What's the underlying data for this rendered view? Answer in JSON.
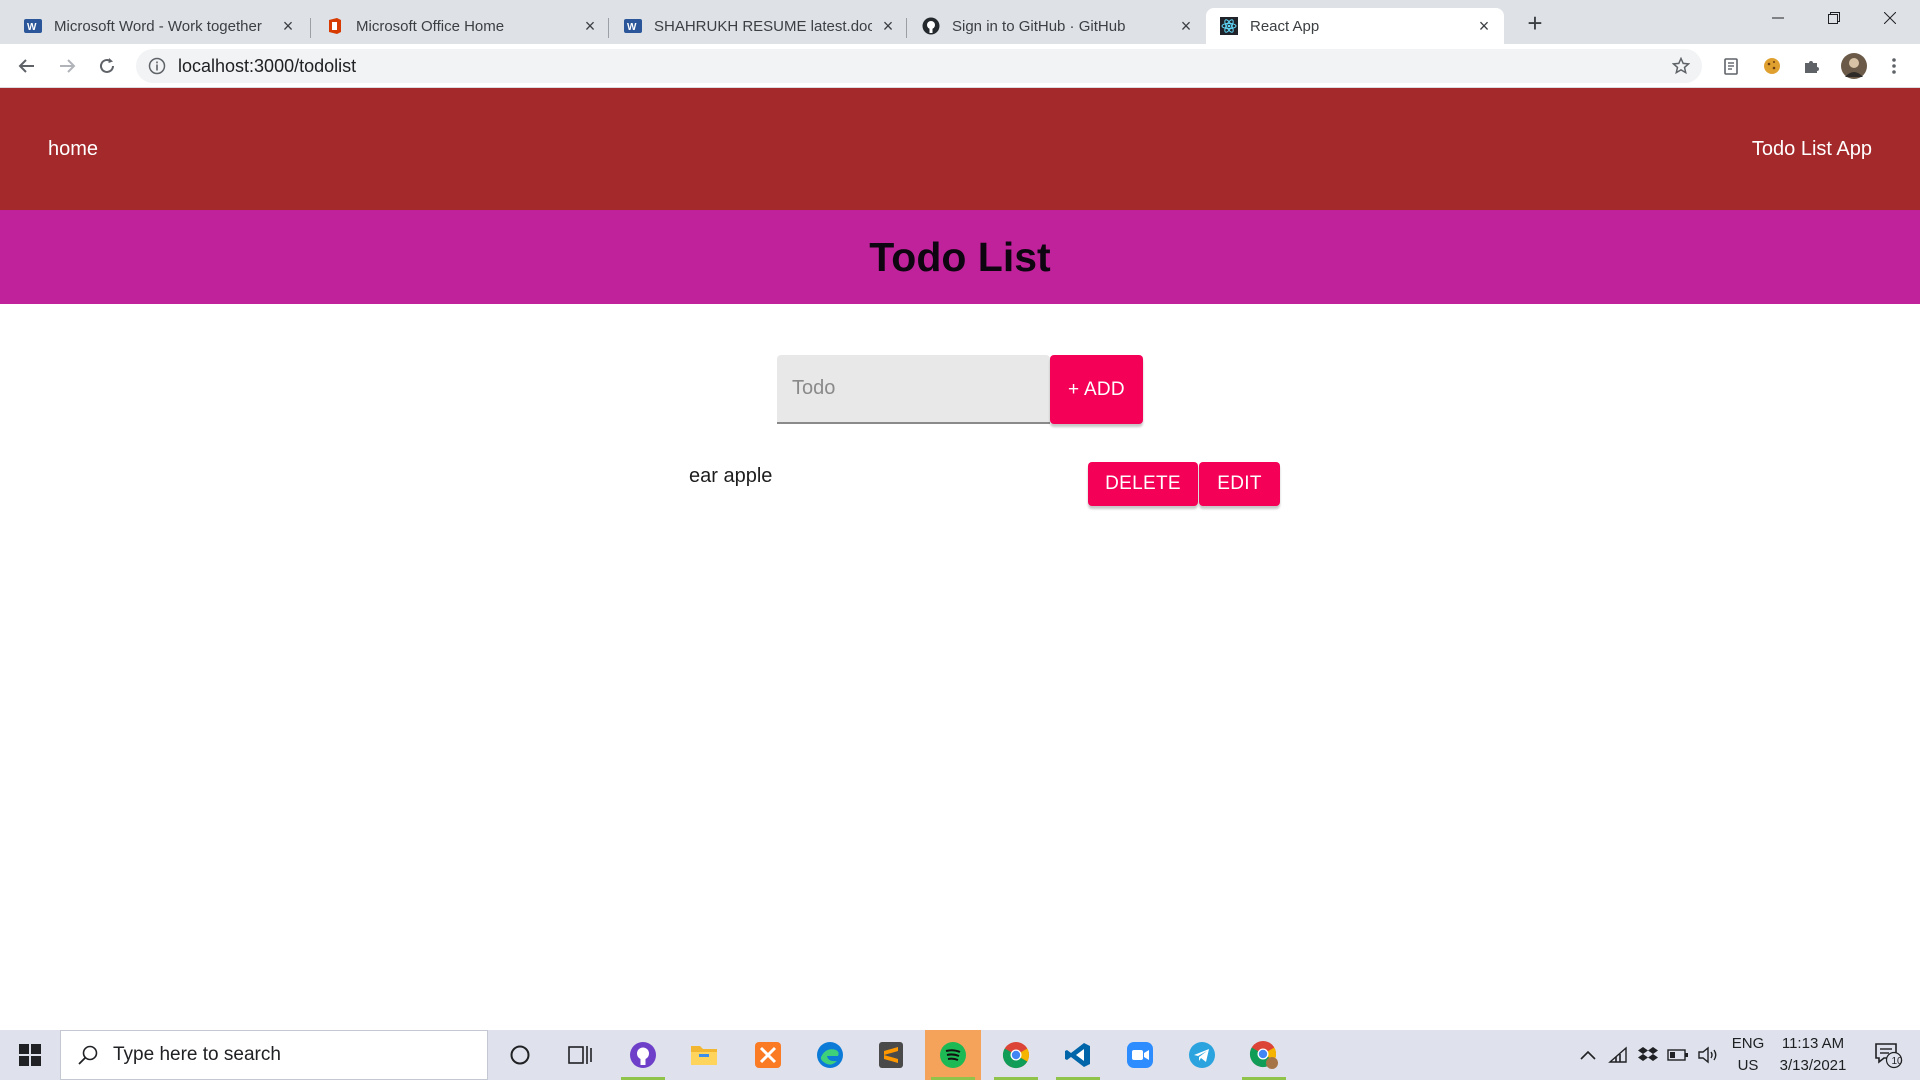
{
  "browser": {
    "tabs": [
      {
        "title": "Microsoft Word - Work together",
        "icon": "word-icon",
        "active": false
      },
      {
        "title": "Microsoft Office Home",
        "icon": "office-icon",
        "active": false
      },
      {
        "title": "SHAHRUKH RESUME latest.docx",
        "icon": "word-icon",
        "active": false
      },
      {
        "title": "Sign in to GitHub · GitHub",
        "icon": "github-icon",
        "active": false
      },
      {
        "title": "React App",
        "icon": "react-icon",
        "active": true
      }
    ],
    "url": "localhost:3000/todolist"
  },
  "app": {
    "nav_home": "home",
    "brand": "Todo List App",
    "title": "Todo List",
    "input_placeholder": "Todo",
    "add_label": "+ ADD",
    "todos": [
      {
        "text": "ear apple",
        "delete_label": "DELETE",
        "edit_label": "EDIT"
      }
    ],
    "colors": {
      "header": "#a4292b",
      "titlebar": "#c0229b",
      "button": "#f50057"
    }
  },
  "taskbar": {
    "search_placeholder": "Type here to search",
    "apps": [
      "cortana-icon",
      "task-view-icon",
      "github-desktop-icon",
      "file-explorer-icon",
      "xampp-icon",
      "edge-icon",
      "sublime-text-icon",
      "spotify-icon",
      "chrome-icon",
      "vscode-icon",
      "zoom-icon",
      "telegram-icon",
      "chrome-profile-icon"
    ],
    "language": "ENG",
    "region": "US",
    "time": "11:13 AM",
    "date": "3/13/2021",
    "notification_count": "10"
  }
}
